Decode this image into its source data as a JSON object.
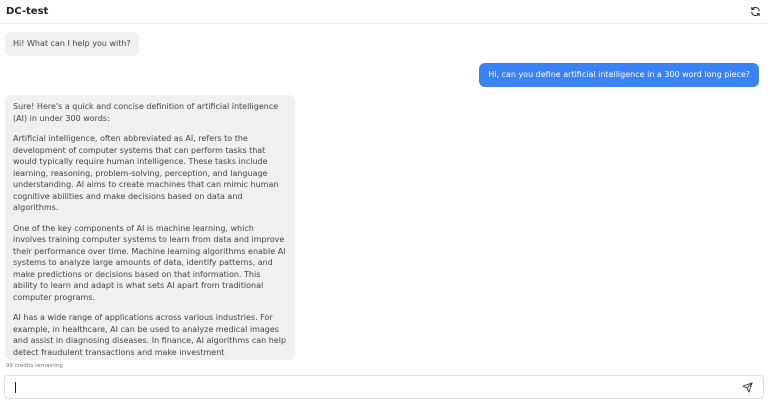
{
  "app": {
    "title": "DC-test"
  },
  "header": {
    "refresh_icon": "refresh-icon"
  },
  "messages": [
    {
      "role": "bot",
      "text": "Hi! What can I help you with?"
    },
    {
      "role": "user",
      "text": "Hi, can you define artificial intelligence in a 300 word long piece?"
    },
    {
      "role": "bot",
      "paragraphs": [
        "Sure! Here's a quick and concise definition of artificial intelligence (AI) in under 300 words:",
        "Artificial intelligence, often abbreviated as AI, refers to the development of computer systems that can perform tasks that would typically require human intelligence. These tasks include learning, reasoning, problem-solving, perception, and language understanding. AI aims to create machines that can mimic human cognitive abilities and make decisions based on data and algorithms.",
        "One of the key components of AI is machine learning, which involves training computer systems to learn from data and improve their performance over time. Machine learning algorithms enable AI systems to analyze large amounts of data, identify patterns, and make predictions or decisions based on that information. This ability to learn and adapt is what sets AI apart from traditional computer programs.",
        "AI has a wide range of applications across various industries. For example, in healthcare, AI can be used to analyze medical images and assist in diagnosing diseases. In finance, AI algorithms can help detect fraudulent transactions and make investment recommendations. AI-powered virtual assistants like Siri and Alexa have become commonplace, providing users with personalized"
      ]
    }
  ],
  "footer": {
    "credits": "99 credits remaining",
    "input_value": "",
    "send_icon": "send-icon"
  }
}
